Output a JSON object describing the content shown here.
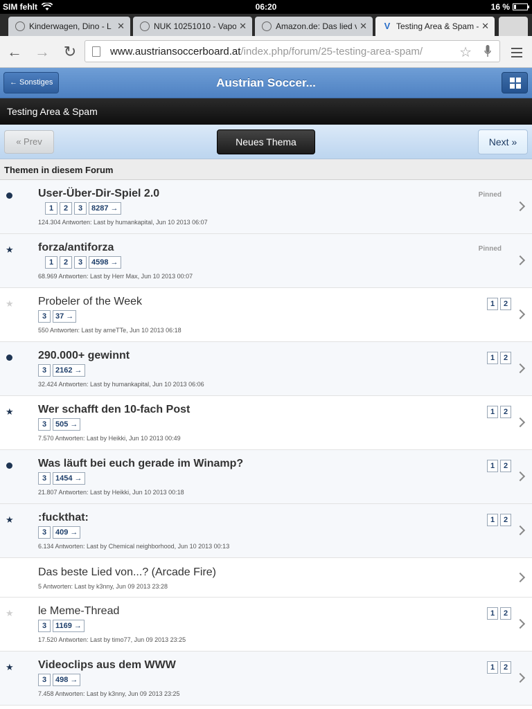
{
  "status": {
    "carrier": "SIM fehlt",
    "time": "06:20",
    "battery": "16 %",
    "battery_level": 0.16
  },
  "tabs": [
    {
      "label": "Kinderwagen, Dino - L",
      "icon": "globe-icon",
      "active": false
    },
    {
      "label": "NUK 10251010 - Vapo",
      "icon": "globe-icon",
      "active": false
    },
    {
      "label": "Amazon.de: Das lied v",
      "icon": "globe-icon",
      "active": false
    },
    {
      "label": "Testing Area & Spam -",
      "icon": "forum-favicon",
      "active": true
    }
  ],
  "url": {
    "host": "www.austriansoccerboard.at",
    "path": "/index.php/forum/25-testing-area-spam/"
  },
  "header": {
    "back_label": "← Sonstiges",
    "title": "Austrian Soccer..."
  },
  "forum_title": "Testing Area & Spam",
  "pager": {
    "prev": "« Prev",
    "new_thread": "Neues Thema",
    "next": "Next »"
  },
  "section_title": "Themen in diesem Forum",
  "threads": [
    {
      "title": "User-Über-Dir-Spiel 2.0",
      "bold": true,
      "marker": "dot",
      "pages": [
        "1",
        "2",
        "3",
        "8287 →"
      ],
      "meta": "124.304 Antworten: Last by humankapital, Jun 10 2013 06:07",
      "pinned": "Pinned",
      "rpages": []
    },
    {
      "title": "forza/antiforza",
      "bold": true,
      "marker": "star-dark",
      "pages": [
        "1",
        "2",
        "3",
        "4598 →"
      ],
      "meta": "68.969 Antworten: Last by Herr Max, Jun 10 2013 00:07",
      "pinned": "Pinned",
      "rpages": []
    },
    {
      "title": "Probeler of the Week",
      "bold": false,
      "marker": "star-light",
      "pages": [
        "3",
        "37 →"
      ],
      "meta": "550 Antworten: Last by arneTTe, Jun 10 2013 06:18",
      "pinned": "",
      "rpages": [
        "1",
        "2"
      ]
    },
    {
      "title": "290.000+ gewinnt",
      "bold": true,
      "marker": "dot",
      "pages": [
        "3",
        "2162 →"
      ],
      "meta": "32.424 Antworten: Last by humankapital, Jun 10 2013 06:06",
      "pinned": "",
      "rpages": [
        "1",
        "2"
      ]
    },
    {
      "title": "Wer schafft den 10-fach Post",
      "bold": true,
      "marker": "star-dark",
      "pages": [
        "3",
        "505 →"
      ],
      "meta": "7.570 Antworten: Last by Heikki, Jun 10 2013 00:49",
      "pinned": "",
      "rpages": [
        "1",
        "2"
      ]
    },
    {
      "title": "Was läuft bei euch gerade im Winamp?",
      "bold": true,
      "marker": "dot",
      "pages": [
        "3",
        "1454 →"
      ],
      "meta": "21.807 Antworten: Last by Heikki, Jun 10 2013 00:18",
      "pinned": "",
      "rpages": [
        "1",
        "2"
      ]
    },
    {
      "title": ":fuckthat:",
      "bold": true,
      "marker": "star-dark",
      "pages": [
        "3",
        "409 →"
      ],
      "meta": "6.134 Antworten: Last by Chemical neighborhood, Jun 10 2013 00:13",
      "pinned": "",
      "rpages": [
        "1",
        "2"
      ]
    },
    {
      "title": "Das beste Lied von...? (Arcade Fire)",
      "bold": false,
      "marker": "none",
      "pages": [],
      "meta": "5 Antworten: Last by k3nny, Jun 09 2013 23:28",
      "pinned": "",
      "rpages": []
    },
    {
      "title": "le Meme-Thread",
      "bold": false,
      "marker": "star-light",
      "pages": [
        "3",
        "1169 →"
      ],
      "meta": "17.520 Antworten: Last by timo77, Jun 09 2013 23:25",
      "pinned": "",
      "rpages": [
        "1",
        "2"
      ]
    },
    {
      "title": "Videoclips aus dem WWW",
      "bold": true,
      "marker": "star-dark",
      "pages": [
        "3",
        "498 →"
      ],
      "meta": "7.458 Antworten: Last by k3nny, Jun 09 2013 23:25",
      "pinned": "",
      "rpages": [
        "1",
        "2"
      ]
    }
  ]
}
